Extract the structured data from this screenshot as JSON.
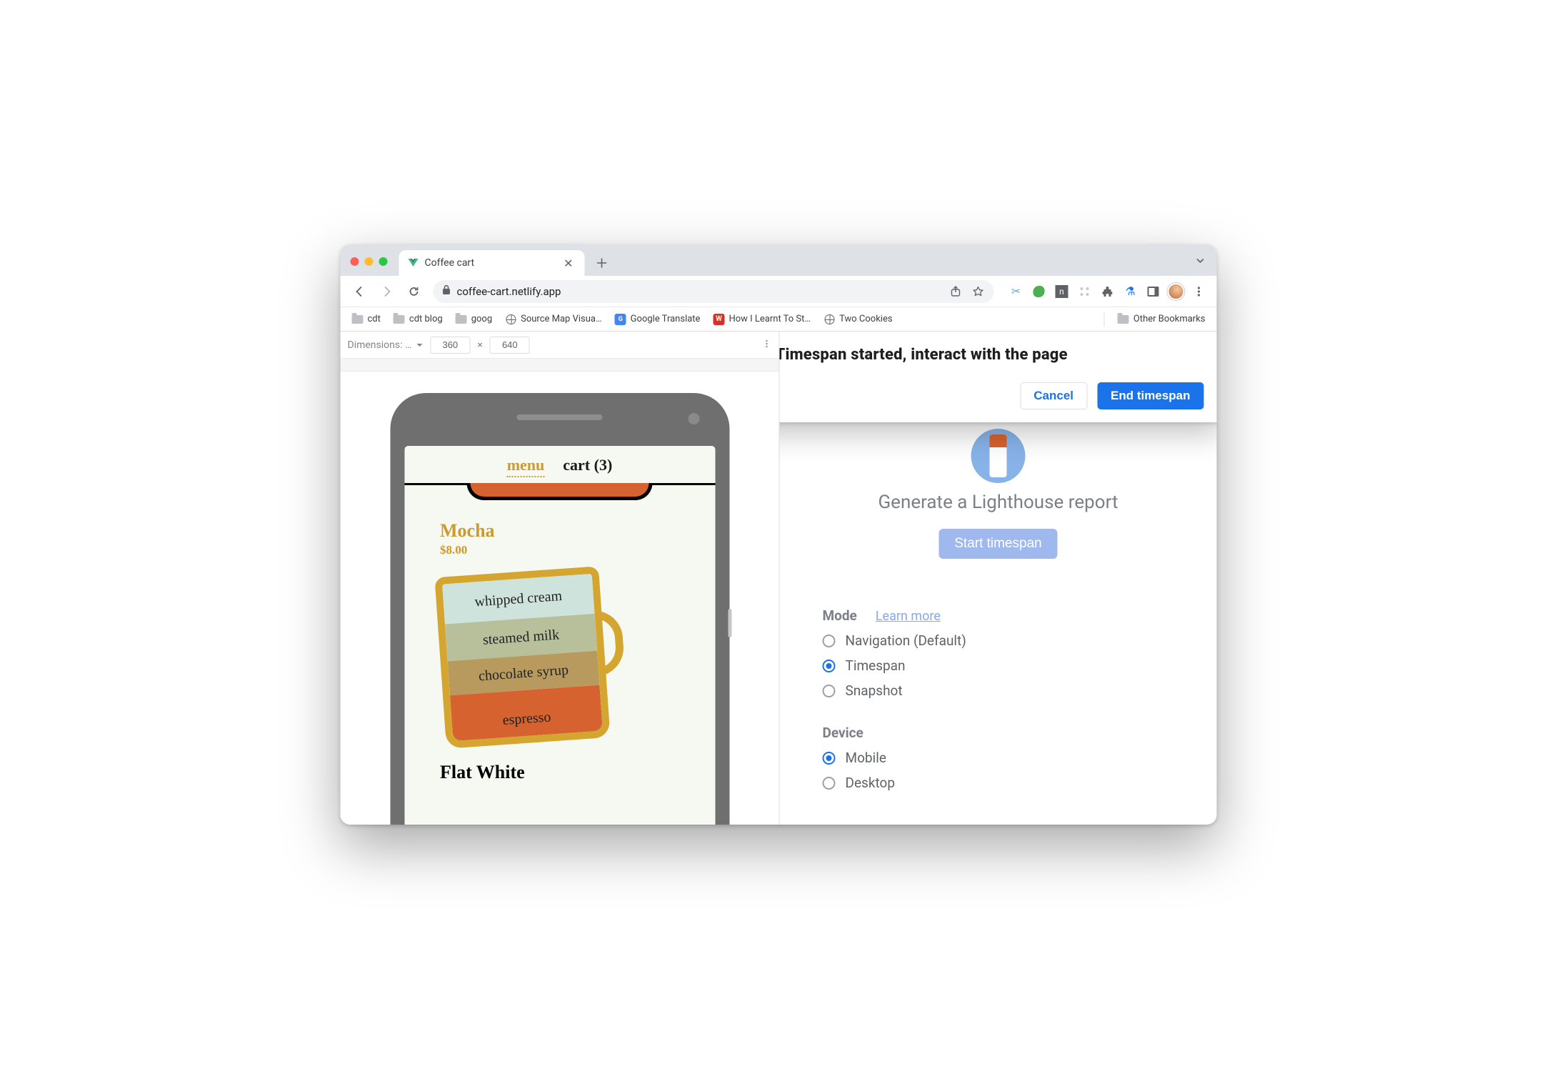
{
  "tab": {
    "title": "Coffee cart"
  },
  "url": "coffee-cart.netlify.app",
  "omnibox": {
    "placeholder": ""
  },
  "bookmarks": {
    "items": [
      {
        "label": "cdt",
        "type": "folder"
      },
      {
        "label": "cdt blog",
        "type": "folder"
      },
      {
        "label": "goog",
        "type": "folder"
      },
      {
        "label": "Source Map Visua…",
        "type": "globe"
      },
      {
        "label": "Google Translate",
        "type": "gtr"
      },
      {
        "label": "How I Learnt To St…",
        "type": "wh"
      },
      {
        "label": "Two Cookies",
        "type": "globe"
      }
    ],
    "overflow_label": "Other Bookmarks"
  },
  "device_bar": {
    "label": "Dimensions: …",
    "width": "360",
    "height": "640",
    "times": "×"
  },
  "app": {
    "nav": {
      "menu": "menu",
      "cart": "cart (3)"
    },
    "product": {
      "name": "Mocha",
      "price": "$8.00",
      "layers": [
        "whipped cream",
        "steamed milk",
        "chocolate syrup",
        "espresso"
      ]
    },
    "next_product_name": "Flat White"
  },
  "lighthouse": {
    "title": "Generate a Lighthouse report",
    "start_btn": "Start timespan",
    "mode_label": "Mode",
    "learn_more": "Learn more",
    "modes": [
      "Navigation (Default)",
      "Timespan",
      "Snapshot"
    ],
    "mode_selected_index": 1,
    "device_label": "Device",
    "devices": [
      "Mobile",
      "Desktop"
    ],
    "device_selected_index": 0
  },
  "modal": {
    "title": "Timespan started, interact with the page",
    "cancel": "Cancel",
    "end": "End timespan"
  }
}
